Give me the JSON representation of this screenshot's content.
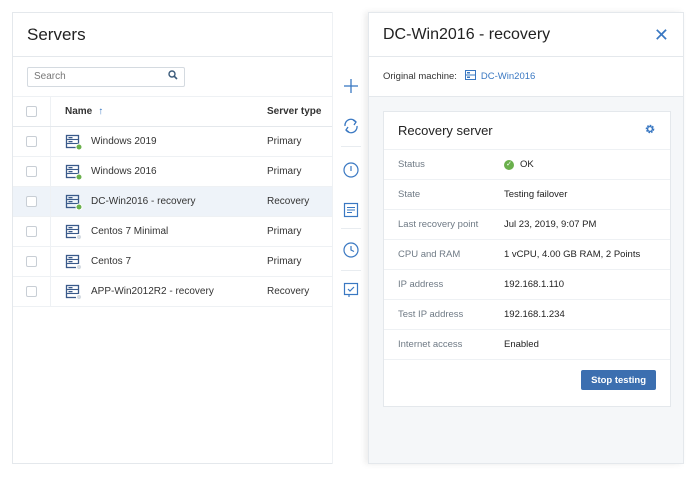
{
  "servers": {
    "title": "Servers",
    "search_placeholder": "Search",
    "columns": {
      "name": "Name",
      "sort_indicator": "↑",
      "type": "Server type"
    },
    "rows": [
      {
        "name": "Windows 2019",
        "type": "Primary",
        "status": "ok"
      },
      {
        "name": "Windows 2016",
        "type": "Primary",
        "status": "ok"
      },
      {
        "name": "DC-Win2016 - recovery",
        "type": "Recovery",
        "status": "ok",
        "selected": true
      },
      {
        "name": "Centos 7 Minimal",
        "type": "Primary",
        "status": "none"
      },
      {
        "name": "Centos 7",
        "type": "Primary",
        "status": "none"
      },
      {
        "name": "APP-Win2012R2 - recovery",
        "type": "Recovery",
        "status": "none"
      }
    ]
  },
  "toolbar": {
    "icons": [
      "plus-icon",
      "sync-icon",
      "power-icon",
      "console-icon",
      "clock-icon",
      "checklist-icon"
    ]
  },
  "detail": {
    "title": "DC-Win2016 - recovery",
    "original_machine_label": "Original machine:",
    "original_machine_value": "DC-Win2016",
    "card": {
      "title": "Recovery server",
      "props": [
        {
          "label": "Status",
          "value": "OK"
        },
        {
          "label": "State",
          "value": "Testing failover"
        },
        {
          "label": "Last recovery point",
          "value": "Jul 23, 2019, 9:07 PM"
        },
        {
          "label": "CPU and RAM",
          "value": "1 vCPU, 4.00 GB RAM, 2 Points"
        },
        {
          "label": "IP address",
          "value": "192.168.1.110"
        },
        {
          "label": "Test IP address",
          "value": "192.168.1.234"
        },
        {
          "label": "Internet access",
          "value": "Enabled"
        }
      ],
      "stop_button": "Stop testing"
    }
  },
  "colors": {
    "accent": "#3a78c2",
    "ok": "#6ab04c",
    "button": "#3c6fb0"
  }
}
